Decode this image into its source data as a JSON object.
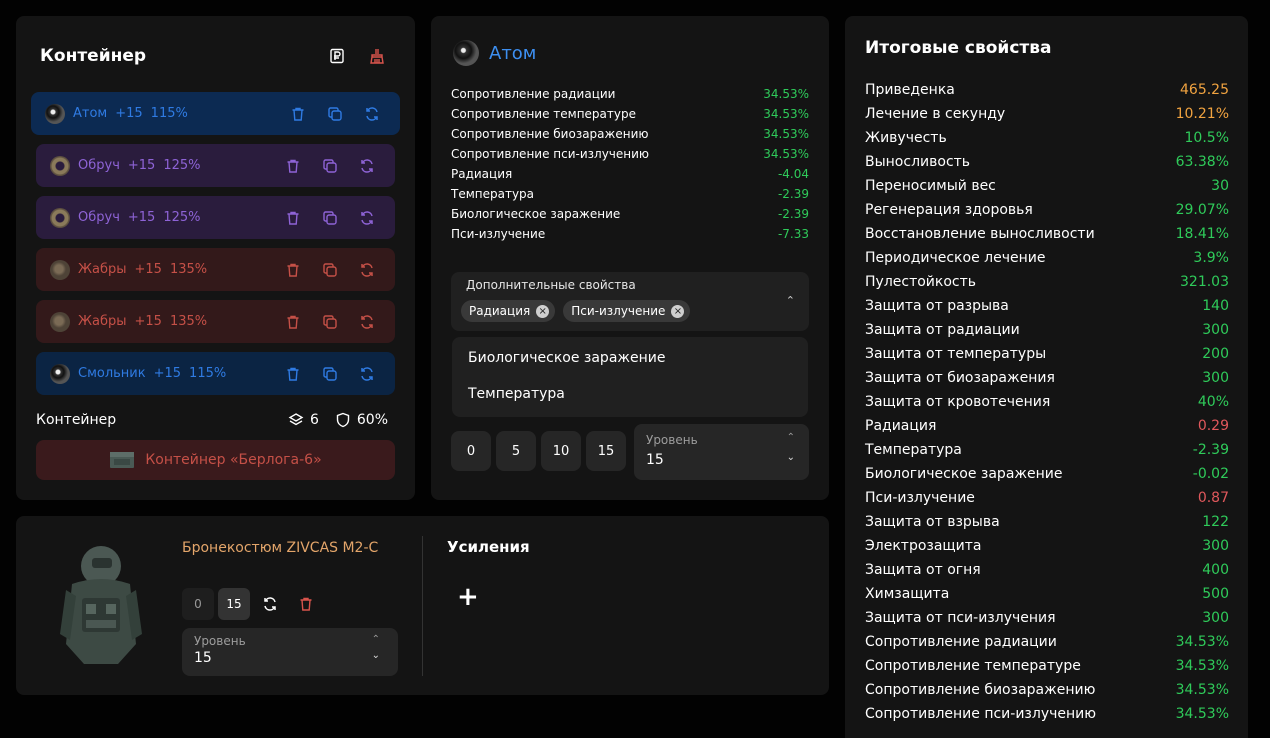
{
  "left": {
    "title": "Контейнер",
    "artifacts": [
      {
        "name": "Атом",
        "level": "+15",
        "percent": "115%",
        "color": "blue",
        "selected": true
      },
      {
        "name": "Обруч",
        "level": "+15",
        "percent": "125%",
        "color": "purple"
      },
      {
        "name": "Обруч",
        "level": "+15",
        "percent": "125%",
        "color": "purple"
      },
      {
        "name": "Жабры",
        "level": "+15",
        "percent": "135%",
        "color": "red"
      },
      {
        "name": "Жабры",
        "level": "+15",
        "percent": "135%",
        "color": "red"
      },
      {
        "name": "Смольник",
        "level": "+15",
        "percent": "115%",
        "color": "blue"
      }
    ],
    "container_label": "Контейнер",
    "slots": "6",
    "protection": "60%",
    "container_name": "Контейнер «Берлога-6»"
  },
  "middle": {
    "artifact_name": "Атом",
    "props": [
      {
        "label": "Сопротивление радиации",
        "value": "34.53%",
        "tone": "green"
      },
      {
        "label": "Сопротивление температуре",
        "value": "34.53%",
        "tone": "green"
      },
      {
        "label": "Сопротивление биозаражению",
        "value": "34.53%",
        "tone": "green"
      },
      {
        "label": "Сопротивление пси-излучению",
        "value": "34.53%",
        "tone": "green"
      },
      {
        "label": "Радиация",
        "value": "-4.04",
        "tone": "green"
      },
      {
        "label": "Температура",
        "value": "-2.39",
        "tone": "green"
      },
      {
        "label": "Биологическое заражение",
        "value": "-2.39",
        "tone": "green"
      },
      {
        "label": "Пси-излучение",
        "value": "-7.33",
        "tone": "green"
      }
    ],
    "extra_label": "Дополнительные свойства",
    "chips": [
      "Радиация",
      "Пси-излучение"
    ],
    "options": [
      "Биологическое заражение",
      "Температура"
    ],
    "level_buttons": [
      "0",
      "5",
      "10",
      "15"
    ],
    "level_caption": "Уровень",
    "level_value": "15"
  },
  "bottom": {
    "armor_name": "Бронекостюм ZIVCAS M2-C",
    "btn_0": "0",
    "btn_15": "15",
    "level_caption": "Уровень",
    "level_value": "15",
    "boosts_title": "Усиления",
    "add_label": "+"
  },
  "right": {
    "title": "Итоговые свойства",
    "props": [
      {
        "label": "Приведенка",
        "value": "465.25",
        "tone": "orange"
      },
      {
        "label": "Лечение в секунду",
        "value": "10.21%",
        "tone": "orange"
      },
      {
        "label": "Живучесть",
        "value": "10.5%",
        "tone": "green"
      },
      {
        "label": "Выносливость",
        "value": "63.38%",
        "tone": "green"
      },
      {
        "label": "Переносимый вес",
        "value": "30",
        "tone": "green"
      },
      {
        "label": "Регенерация здоровья",
        "value": "29.07%",
        "tone": "green"
      },
      {
        "label": "Восстановление выносливости",
        "value": "18.41%",
        "tone": "green"
      },
      {
        "label": "Периодическое лечение",
        "value": "3.9%",
        "tone": "green"
      },
      {
        "label": "Пулестойкость",
        "value": "321.03",
        "tone": "green"
      },
      {
        "label": "Защита от разрыва",
        "value": "140",
        "tone": "green"
      },
      {
        "label": "Защита от радиации",
        "value": "300",
        "tone": "green"
      },
      {
        "label": "Защита от температуры",
        "value": "200",
        "tone": "green"
      },
      {
        "label": "Защита от биозаражения",
        "value": "300",
        "tone": "green"
      },
      {
        "label": "Защита от кровотечения",
        "value": "40%",
        "tone": "green"
      },
      {
        "label": "Радиация",
        "value": "0.29",
        "tone": "red"
      },
      {
        "label": "Температура",
        "value": "-2.39",
        "tone": "green"
      },
      {
        "label": "Биологическое заражение",
        "value": "-0.02",
        "tone": "green"
      },
      {
        "label": "Пси-излучение",
        "value": "0.87",
        "tone": "red"
      },
      {
        "label": "Защита от взрыва",
        "value": "122",
        "tone": "green"
      },
      {
        "label": "Электрозащита",
        "value": "300",
        "tone": "green"
      },
      {
        "label": "Защита от огня",
        "value": "400",
        "tone": "green"
      },
      {
        "label": "Химзащита",
        "value": "500",
        "tone": "green"
      },
      {
        "label": "Защита от пси-излучения",
        "value": "300",
        "tone": "green"
      },
      {
        "label": "Сопротивление радиации",
        "value": "34.53%",
        "tone": "green"
      },
      {
        "label": "Сопротивление температуре",
        "value": "34.53%",
        "tone": "green"
      },
      {
        "label": "Сопротивление биозаражению",
        "value": "34.53%",
        "tone": "green"
      },
      {
        "label": "Сопротивление пси-излучению",
        "value": "34.53%",
        "tone": "green"
      }
    ]
  }
}
